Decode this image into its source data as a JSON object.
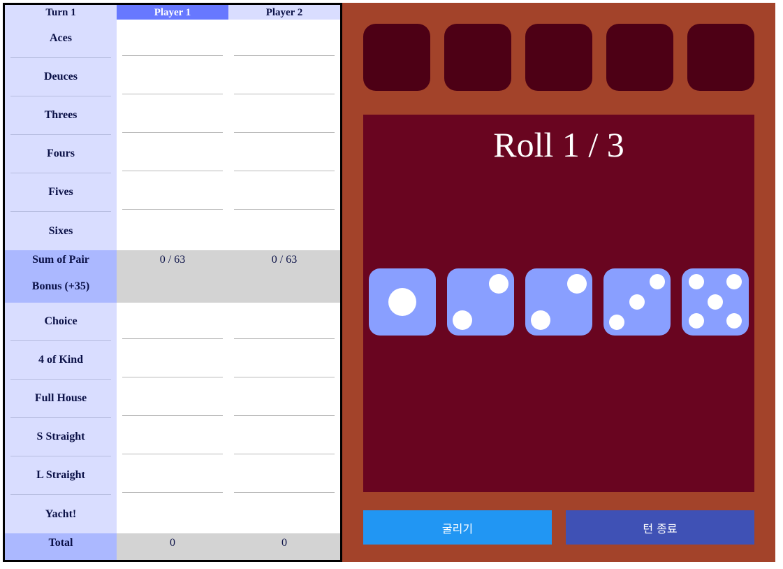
{
  "scoresheet": {
    "turn_label": "Turn 1",
    "players": [
      "Player 1",
      "Player 2"
    ],
    "upper": [
      "Aces",
      "Deuces",
      "Threes",
      "Fours",
      "Fives",
      "Sixes"
    ],
    "bonus": {
      "sum_label": "Sum of Pair",
      "bonus_label": "Bonus (+35)",
      "p1": "0 / 63",
      "p2": "0 / 63"
    },
    "lower": [
      "Choice",
      "4 of Kind",
      "Full House",
      "S Straight",
      "L Straight",
      "Yacht!"
    ],
    "total": {
      "label": "Total",
      "p1": "0",
      "p2": "0"
    }
  },
  "board": {
    "roll_indicator": "Roll 1 / 3",
    "kept_slots": 5,
    "dice": [
      1,
      2,
      2,
      3,
      5
    ],
    "colors": {
      "felt": "#690520",
      "frame": "#a3432a",
      "die": "#899fff",
      "kept_slot": "#4d0015"
    },
    "buttons": {
      "roll": "굴리기",
      "end_turn": "턴 종료"
    }
  }
}
